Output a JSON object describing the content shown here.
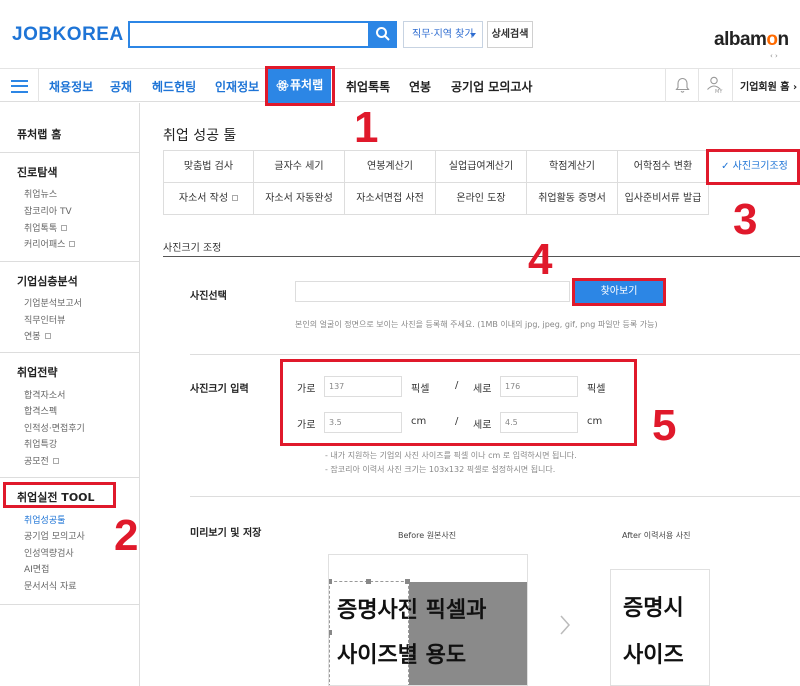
{
  "header": {
    "logo": "JOBKOREA",
    "search": {
      "value": "",
      "placeholder": ""
    },
    "region_button": "직무·지역 찾기",
    "detail_search": "상세검색",
    "partner_logo_a": "albam",
    "partner_logo_o": "o",
    "partner_logo_n": "n",
    "partner_arrows": "‹ ›"
  },
  "nav": {
    "items": [
      "채용정보",
      "공채",
      "헤드헌팅",
      "인재정보",
      "퓨처랩",
      "취업톡톡",
      "연봉",
      "공기업 모의고사"
    ],
    "active": "퓨처랩",
    "user_sub": "MY",
    "member_menu": "기업회원 홈 ›"
  },
  "sidebar": {
    "home": "퓨처랩 홈",
    "groups": [
      {
        "title": "진로탐색",
        "items": [
          "취업뉴스",
          "잡코리아 TV",
          "취업톡톡",
          "커리어패스"
        ]
      },
      {
        "title": "기업심층분석",
        "items": [
          "기업분석보고서",
          "직무인터뷰",
          "연봉"
        ]
      },
      {
        "title": "취업전략",
        "items": [
          "합격자소서",
          "합격스펙",
          "인적성·면접후기",
          "취업특강",
          "공모전"
        ]
      },
      {
        "title": "취업실전 TOOL",
        "items": [
          "취업성공툴",
          "공기업 모의고사",
          "인성역량검사",
          "AI면접",
          "문서서식 자료"
        ]
      }
    ]
  },
  "main": {
    "title": "취업 성공 툴",
    "tools_row1": [
      "맞춤법 검사",
      "글자수 세기",
      "연봉계산기",
      "실업급여계산기",
      "학점계산기",
      "어학점수 변환",
      "사진크기조정"
    ],
    "tools_row2": [
      "자소서 작성",
      "자소서 자동완성",
      "자소서면접 사전",
      "온라인 도장",
      "취업활동 증명서",
      "입사준비서류 발급"
    ],
    "active_tool": "✓ 사진크기조정",
    "section_title": "사진크기 조정",
    "photo_select": {
      "label": "사진선택",
      "file_value": "",
      "button": "찾아보기",
      "help": "본인의 얼굴이 정면으로 보이는 사진을 등록해 주세요. (1MB 이내의 jpg, jpeg, gif, png 파일만 등록 가능)"
    },
    "size_input": {
      "label": "사진크기 입력",
      "row1": {
        "w_label": "가로",
        "w_value": "137",
        "w_unit": "픽셀",
        "sep": "/",
        "h_label": "세로",
        "h_value": "176",
        "h_unit": "픽셀"
      },
      "row2": {
        "w_label": "가로",
        "w_value": "3.5",
        "w_unit": "cm",
        "sep": "/",
        "h_label": "세로",
        "h_value": "4.5",
        "h_unit": "cm"
      },
      "note1": "- 내가 지원하는 기업의 사진 사이즈를 픽셀 이나 cm 로 입력하시면 됩니다.",
      "note2": "- 잡코리아 이력서 사진 크기는 103x132 픽셀로 설정하시면 됩니다."
    },
    "preview": {
      "label": "미리보기 및 저장",
      "before_caption": "Before 원본사진",
      "after_caption": "After 이력서용 사진",
      "before_line1": "증명사진 픽셀과",
      "before_line2": "사이즈별 용도",
      "after_line1": "증명시",
      "after_line2": "사이즈"
    }
  },
  "annotations": [
    "1",
    "2",
    "3",
    "4",
    "5"
  ],
  "colors": {
    "brand_blue": "#2c86e5",
    "annotation_red": "#e0192b",
    "albamon_orange": "#ff6a00"
  }
}
